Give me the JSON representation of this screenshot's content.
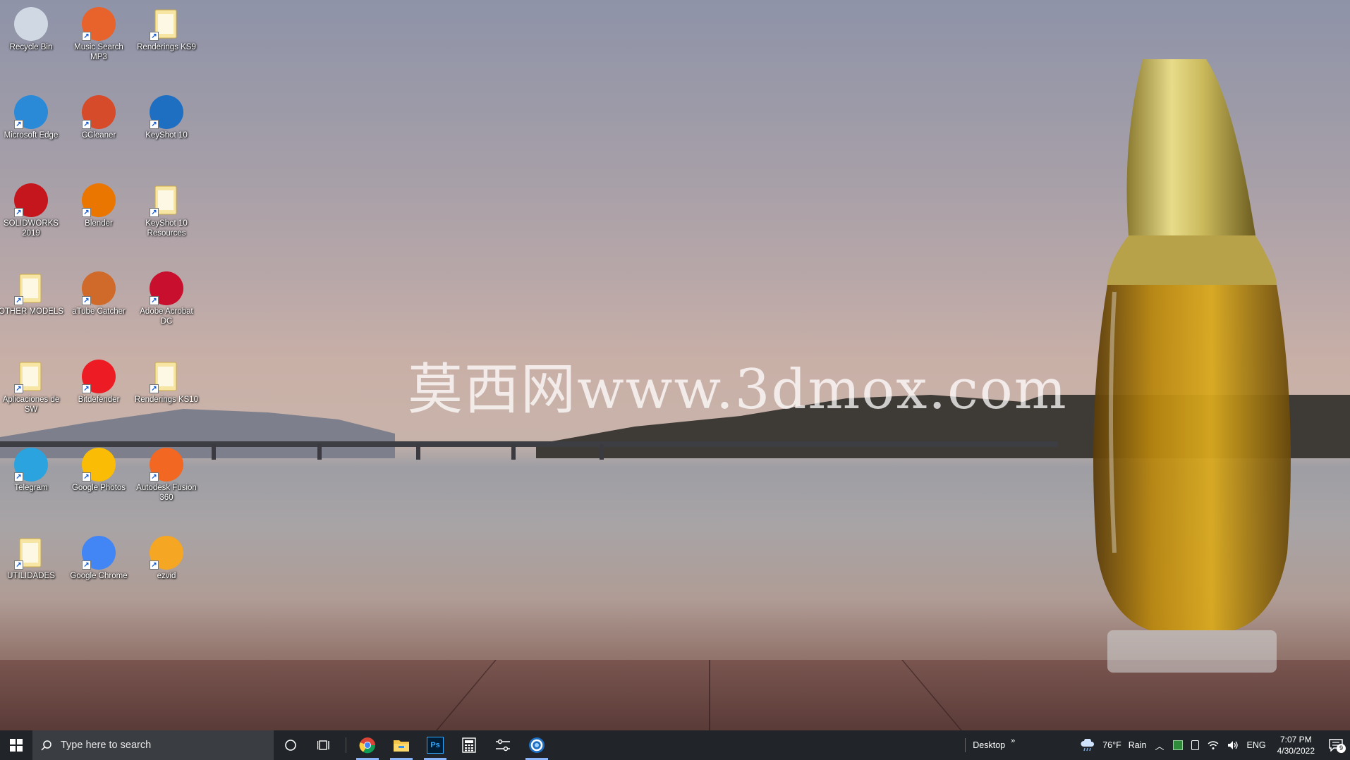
{
  "desktop": {
    "watermark": "莫西网www.3dmox.com",
    "icons": [
      {
        "label": "Recycle Bin",
        "icon": "recycle-bin-icon",
        "color": "#cfd8e3"
      },
      {
        "label": "Music Search MP3",
        "icon": "music-search-icon",
        "color": "#e8622c"
      },
      {
        "label": "Renderings KS9",
        "icon": "folder-icon",
        "color": "#f3d67a"
      },
      {
        "label": "Microsoft Edge",
        "icon": "edge-icon",
        "color": "#2a8ad8"
      },
      {
        "label": "CCleaner",
        "icon": "ccleaner-icon",
        "color": "#d64b2a"
      },
      {
        "label": "KeyShot 10",
        "icon": "keyshot-icon",
        "color": "#1e6fc2"
      },
      {
        "label": "SOLIDWORKS 2019",
        "icon": "solidworks-icon",
        "color": "#c4161c"
      },
      {
        "label": "Blender",
        "icon": "blender-icon",
        "color": "#ea7600"
      },
      {
        "label": "KeyShot 10 Resources",
        "icon": "folder-icon",
        "color": "#f3d67a"
      },
      {
        "label": "OTHER MODELS",
        "icon": "folder-icon",
        "color": "#f3d67a"
      },
      {
        "label": "aTube Catcher",
        "icon": "atube-catcher-icon",
        "color": "#d06a2a"
      },
      {
        "label": "Adobe Acrobat DC",
        "icon": "acrobat-icon",
        "color": "#c8102e"
      },
      {
        "label": "Aplicaciones de SW",
        "icon": "folder-icon",
        "color": "#f3d67a"
      },
      {
        "label": "Bitdefender",
        "icon": "bitdefender-icon",
        "color": "#ed1c24"
      },
      {
        "label": "Renderings KS10",
        "icon": "folder-icon",
        "color": "#f3d67a"
      },
      {
        "label": "Telegram",
        "icon": "telegram-icon",
        "color": "#2aa3df"
      },
      {
        "label": "Google Photos",
        "icon": "google-photos-icon",
        "color": "#fbbc05"
      },
      {
        "label": "Autodesk Fusion 360",
        "icon": "fusion-360-icon",
        "color": "#f26722"
      },
      {
        "label": "UTILIDADES",
        "icon": "folder-icon",
        "color": "#f3d67a"
      },
      {
        "label": "Google Chrome",
        "icon": "chrome-icon",
        "color": "#4285f4"
      },
      {
        "label": "ezvid",
        "icon": "ezvid-icon",
        "color": "#f5a623"
      }
    ]
  },
  "taskbar": {
    "search_placeholder": "Type here to search",
    "pinned": [
      {
        "icon": "cortana-icon"
      },
      {
        "icon": "task-view-icon"
      },
      {
        "icon": "chrome-icon",
        "active": true
      },
      {
        "icon": "file-explorer-icon",
        "active": true
      },
      {
        "icon": "photoshop-icon",
        "label": "Ps",
        "active": true
      },
      {
        "icon": "calculator-icon"
      },
      {
        "icon": "settings-sliders-icon"
      },
      {
        "icon": "keyshot-icon",
        "active": true
      }
    ],
    "desktop_toolbar": "Desktop",
    "weather": {
      "temp": "76°F",
      "condition": "Rain"
    },
    "language": "ENG",
    "time": "7:07 PM",
    "date": "4/30/2022",
    "notifications_count": "9"
  },
  "colors": {
    "taskbar_bg": "#212529",
    "search_bg": "#3a3d42",
    "accent": "#8ab4f8"
  }
}
